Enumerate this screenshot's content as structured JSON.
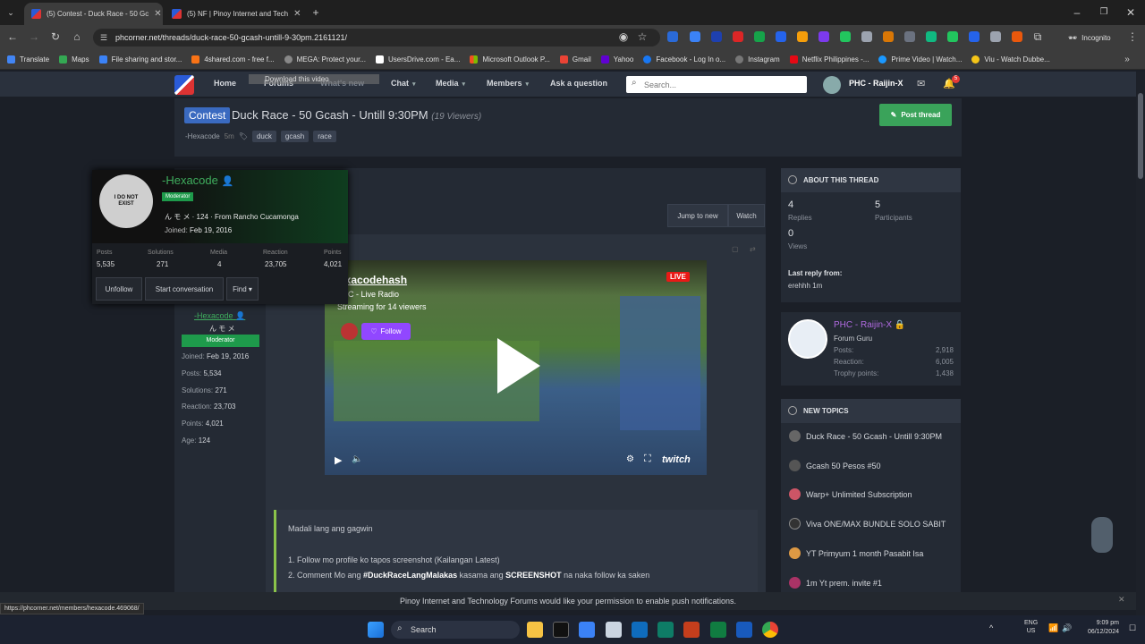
{
  "browser": {
    "tabs": [
      {
        "title": "(5) Contest - Duck Race - 50 Gc"
      },
      {
        "title": "(5) NF | Pinoy Internet and Tech"
      }
    ],
    "url": "phcorner.net/threads/duck-race-50-gcash-untill-9-30pm.2161121/",
    "profile_label": "Incognito",
    "bookmarks": [
      "Translate",
      "Maps",
      "File sharing and stor...",
      "4shared.com - free f...",
      "MEGA: Protect your...",
      "UsersDrive.com - Ea...",
      "Microsoft Outlook P...",
      "Gmail",
      "Yahoo",
      "Facebook - Log In o...",
      "Instagram",
      "Netflix Philippines -...",
      "Prime Video | Watch...",
      "Viu - Watch Dubbe..."
    ],
    "download_overlay": "Download this video",
    "status_url": "https://phcorner.net/members/hexacode.469068/"
  },
  "site": {
    "nav": [
      "Home",
      "Forums",
      "What's new",
      "Chat",
      "Media",
      "Members",
      "Ask a question"
    ],
    "search_placeholder": "Search...",
    "user_name": "PHC - Raijin-X",
    "notif_count": "5"
  },
  "thread": {
    "prefix": "Contest",
    "title": "Duck Race - 50 Gcash - Untill 9:30PM",
    "viewers": "(19 Viewers)",
    "author": "-Hexacode",
    "age": "5m",
    "tags": [
      "duck",
      "gcash",
      "race"
    ],
    "post_thread_label": "Post thread",
    "jump_label": "Jump to new",
    "watch_label": "Watch"
  },
  "hovercard": {
    "name": "-Hexacode",
    "role": "Moderator",
    "avatar_text": "I DO NOT EXIST",
    "subtitle": "ん モ メ · 124 · From Rancho Cucamonga",
    "joined_label": "Joined:",
    "joined": "Feb 19, 2016",
    "stats": [
      {
        "label": "Posts",
        "value": "5,535"
      },
      {
        "label": "Solutions",
        "value": "271"
      },
      {
        "label": "Media",
        "value": "4"
      },
      {
        "label": "Reaction",
        "value": "23,705"
      },
      {
        "label": "Points",
        "value": "4,021"
      }
    ],
    "unfollow": "Unfollow",
    "start_conv": "Start conversation",
    "find": "Find ▾"
  },
  "postuser": {
    "name": "-Hexacode",
    "sub": "ん モ メ",
    "role": "Moderator",
    "lines": [
      {
        "label": "Joined:",
        "value": "Feb 19, 2016"
      },
      {
        "label": "Posts:",
        "value": "5,534"
      },
      {
        "label": "Solutions:",
        "value": "271"
      },
      {
        "label": "Reaction:",
        "value": "23,703"
      },
      {
        "label": "Points:",
        "value": "4,021"
      },
      {
        "label": "Age:",
        "value": "124"
      }
    ]
  },
  "video": {
    "channel": "exacodehash",
    "subtitle": "C - Live Radio",
    "streaming": "Streaming for 14 viewers",
    "follow": "Follow",
    "live": "LIVE",
    "brand": "twitch"
  },
  "post": {
    "line1": "Madali lang ang gagwin",
    "line2": "1. Follow mo profile ko tapos screenshot (Kailangan Latest)",
    "line3_a": "2. Comment Mo ang ",
    "line3_b": "#DuckRaceLangMalakas",
    "line3_c": " kasama ang ",
    "line3_d": "SCREENSHOT",
    "line3_e": " na naka follow ka saken"
  },
  "about": {
    "heading": "ABOUT THIS THREAD",
    "replies": "4",
    "replies_label": "Replies",
    "participants": "5",
    "participants_label": "Participants",
    "views": "0",
    "views_label": "Views",
    "last_reply_label": "Last reply from:",
    "last_reply": "erehhh 1m"
  },
  "profile": {
    "name": "PHC - Raijin-X",
    "title": "Forum Guru",
    "stats": [
      {
        "label": "Posts:",
        "value": "2,918"
      },
      {
        "label": "Reaction:",
        "value": "6,005"
      },
      {
        "label": "Trophy points:",
        "value": "1,438"
      }
    ]
  },
  "new_topics": {
    "heading": "NEW TOPICS",
    "items": [
      "Duck Race - 50 Gcash - Untill 9:30PM",
      "Gcash 50 Pesos #50",
      "Warp+ Unlimited Subscription",
      "Viva ONE/MAX BUNDLE SOLO SABIT",
      "YT Primyum 1 month Pasabit Isa",
      "1m Yt prem. invite #1"
    ]
  },
  "notification_bar": "Pinoy Internet and Technology Forums would like your permission to enable push notifications.",
  "taskbar": {
    "search": "Search",
    "lang": "ENG",
    "region": "US",
    "time": "9:09 pm",
    "date": "06/12/2024"
  }
}
